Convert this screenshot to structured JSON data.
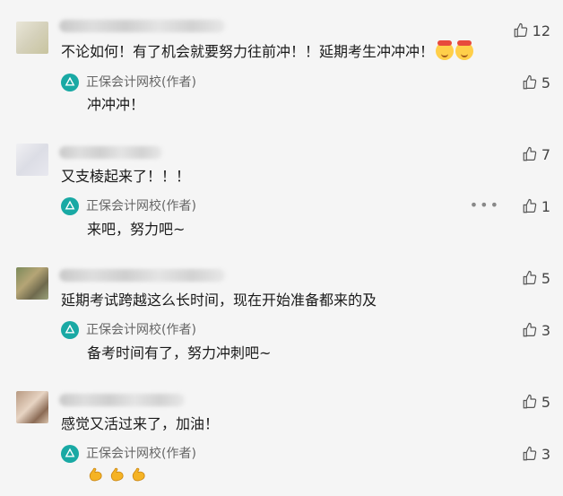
{
  "colors": {
    "accent": "#19a9a4",
    "background": "#f5f5f5"
  },
  "author_label": "正保会计网校(作者)",
  "comments": [
    {
      "text": "不论如何！有了机会就要努力往前冲！！延期考生冲冲冲！",
      "emoji": [
        "party-face-icon",
        "party-face-icon"
      ],
      "likes": "12",
      "reply": {
        "text": "冲冲冲！",
        "likes": "5"
      }
    },
    {
      "text": "又支棱起来了！！！",
      "likes": "7",
      "reply": {
        "text": "来吧，努力吧~",
        "likes": "1",
        "more": "•••"
      }
    },
    {
      "text": "延期考试跨越这么长时间，现在开始准备都来的及",
      "likes": "5",
      "reply": {
        "text": "备考时间有了，努力冲刺吧~",
        "likes": "3"
      }
    },
    {
      "text": "感觉又活过来了，加油！",
      "likes": "5",
      "reply": {
        "text": "",
        "emoji": [
          "flexed-biceps-icon",
          "flexed-biceps-icon",
          "flexed-biceps-icon"
        ],
        "likes": "3"
      }
    }
  ]
}
